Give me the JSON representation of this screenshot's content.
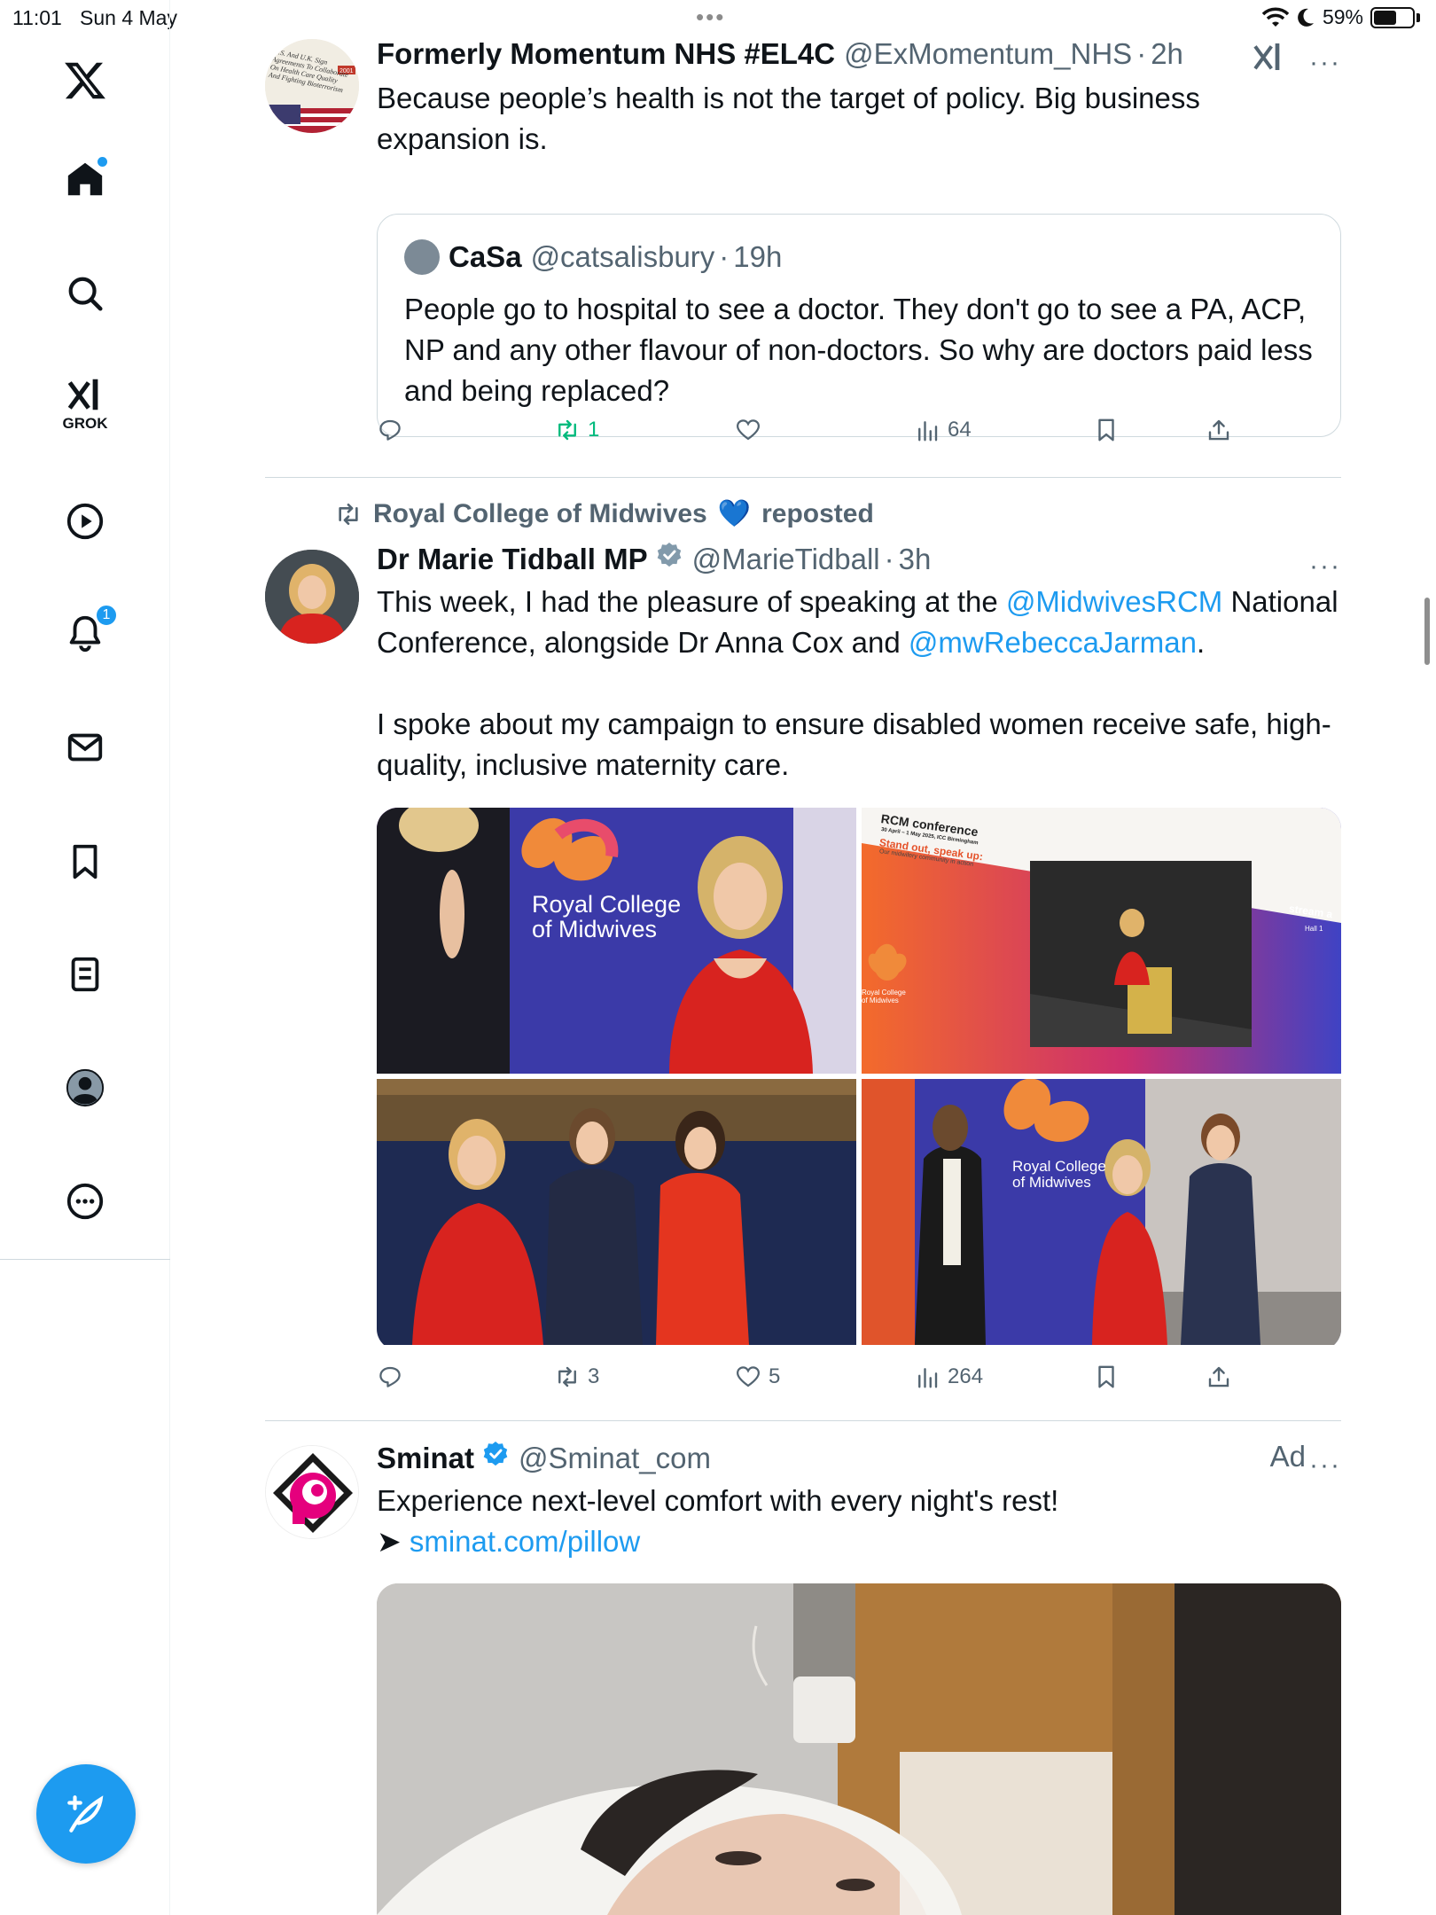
{
  "status": {
    "time": "11:01",
    "date": "Sun 4 May",
    "battery": "59%",
    "battery_level": 0.59
  },
  "sidebar": {
    "items": [
      {
        "name": "home",
        "label": "Home"
      },
      {
        "name": "explore",
        "label": "Explore"
      },
      {
        "name": "grok",
        "label": "GROK"
      },
      {
        "name": "video",
        "label": "Video"
      },
      {
        "name": "notifications",
        "label": "Notifications",
        "badge": "1"
      },
      {
        "name": "messages",
        "label": "Messages"
      },
      {
        "name": "bookmarks",
        "label": "Bookmarks"
      },
      {
        "name": "lists",
        "label": "Lists"
      },
      {
        "name": "profile",
        "label": "Profile"
      },
      {
        "name": "more",
        "label": "More"
      }
    ]
  },
  "tweets": [
    {
      "name": "Formerly Momentum NHS #EL4C",
      "handle": "@ExMomentum_NHS",
      "time": "2h",
      "text": "Because people’s health is not the target of policy. Big business expansion is.",
      "avatar_text": "U.S. And U.K. Sign Agreements To Collaborate On Health Care Quality And Fighting Bioterrorism",
      "avatar_badge": "2001",
      "quote": {
        "name": "CaSa",
        "handle": "@catsalisbury",
        "time": "19h",
        "text": "People go to hospital to see a doctor. They don't go to see a PA, ACP, NP and any other flavour of non-doctors. So why are doctors paid less and being replaced?"
      },
      "stats": {
        "replies": "",
        "reposts": "1",
        "likes": "",
        "views": "64"
      }
    },
    {
      "repost_by": "Royal College of Midwives",
      "repost_emoji": "💙",
      "repost_suffix": "reposted",
      "name": "Dr Marie Tidball MP",
      "handle": "@MarieTidball",
      "time": "3h",
      "text_parts": {
        "p1": "This week, I had the pleasure of speaking at the ",
        "m1": "@MidwivesRCM",
        "p2": " National Conference, alongside Dr Anna Cox and ",
        "m2": "@mwRebeccaJarman",
        "p3": ".",
        "p4": "I spoke about my campaign to ensure disabled women receive safe, high-quality, inclusive maternity care."
      },
      "media": {
        "banner_text": "Royal College of Midwives",
        "screen_title": "RCM conference",
        "screen_dates": "30 April – 1 May 2025, ICC Birmingham",
        "screen_slogan": "Stand out, speak up:",
        "screen_tagline": "Our midwifery community in action",
        "screen_stream": "stream a",
        "screen_hall": "Hall 1",
        "logo_text": "Royal College of Midwives"
      },
      "stats": {
        "replies": "",
        "reposts": "3",
        "likes": "5",
        "views": "264"
      }
    },
    {
      "name": "Sminat",
      "handle": "@Sminat_com",
      "ad_label": "Ad",
      "text": "Experience next-level comfort with every night's rest!",
      "arrow": "➤",
      "link": "sminat.com/pillow"
    }
  ],
  "colors": {
    "accent": "#1d9bf0",
    "repost_green": "#00ba7c",
    "muted": "#536471",
    "rcm_purple": "#3b3aa8",
    "dress_red": "#d8231f",
    "sminat_pink": "#e5007d"
  }
}
